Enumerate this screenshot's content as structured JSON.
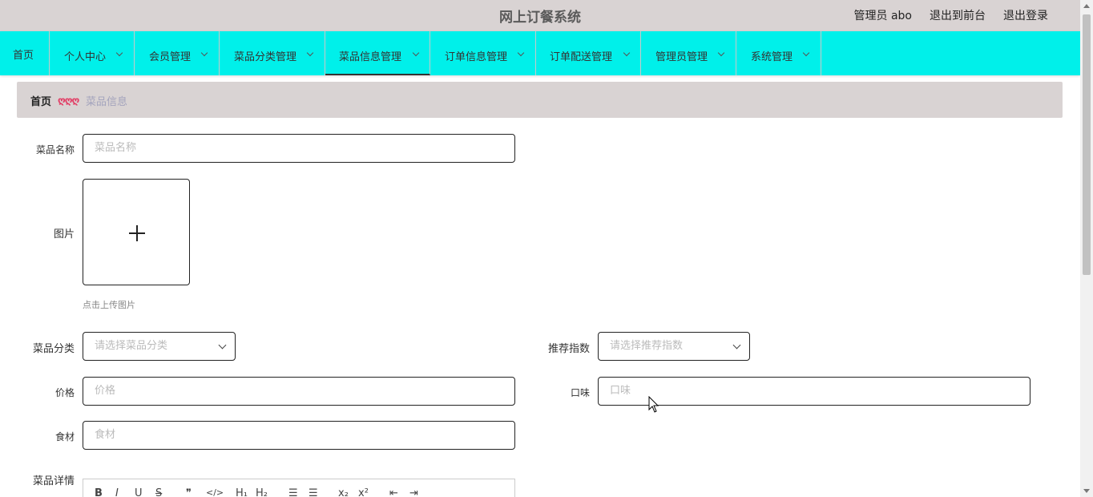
{
  "header": {
    "title": "网上订餐系统",
    "user": "管理员 abo",
    "to_front": "退出到前台",
    "logout": "退出登录"
  },
  "nav": {
    "items": [
      {
        "label": "首页"
      },
      {
        "label": "个人中心"
      },
      {
        "label": "会员管理"
      },
      {
        "label": "菜品分类管理"
      },
      {
        "label": "菜品信息管理"
      },
      {
        "label": "订单信息管理"
      },
      {
        "label": "订单配送管理"
      },
      {
        "label": "管理员管理"
      },
      {
        "label": "系统管理"
      }
    ],
    "active": "菜品信息管理"
  },
  "breadcrumb": {
    "home": "首页",
    "separator": "ღღღ",
    "current": "菜品信息"
  },
  "form": {
    "name": {
      "label": "菜品名称",
      "placeholder": "菜品名称"
    },
    "image": {
      "label": "图片",
      "hint": "点击上传图片"
    },
    "category": {
      "label": "菜品分类",
      "placeholder": "请选择菜品分类"
    },
    "recommend": {
      "label": "推荐指数",
      "placeholder": "请选择推荐指数"
    },
    "price": {
      "label": "价格",
      "placeholder": "价格"
    },
    "taste": {
      "label": "口味",
      "placeholder": "口味"
    },
    "ingredients": {
      "label": "食材",
      "placeholder": "食材"
    },
    "detail": {
      "label": "菜品详情"
    }
  },
  "editor_toolbar": {
    "bold": "B",
    "italic": "I",
    "underline": "U",
    "strike": "S",
    "quote": "❞",
    "code": "</>",
    "h1": "H₁",
    "h2": "H₂",
    "ol": "☰",
    "ul": "☰",
    "sub": "x₂",
    "sup": "x²",
    "outdent": "⇤",
    "indent": "⇥"
  },
  "colors": {
    "nav_bg": "#00f0ea",
    "header_bg": "#d9d3d3",
    "crumb_sep": "#e23c64"
  }
}
